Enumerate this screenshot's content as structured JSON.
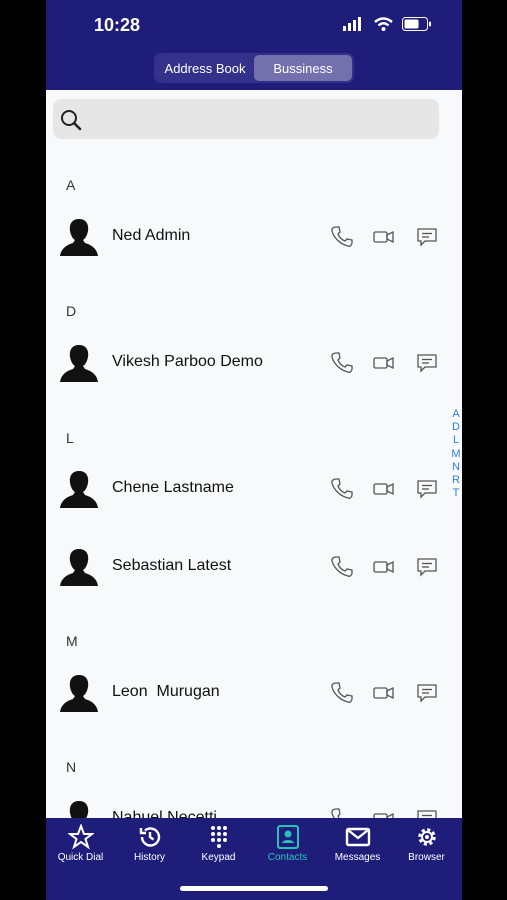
{
  "status_bar": {
    "time": "10:28"
  },
  "segment": {
    "address_book": "Address Book",
    "business": "Bussiness"
  },
  "sections": [
    {
      "letter": "A",
      "contacts": [
        "Ned Admin"
      ]
    },
    {
      "letter": "D",
      "contacts": [
        "Vikesh Parboo Demo"
      ]
    },
    {
      "letter": "L",
      "contacts": [
        "Chene Lastname",
        "Sebastian Latest"
      ]
    },
    {
      "letter": "M",
      "contacts": [
        "Leon  Murugan"
      ]
    },
    {
      "letter": "N",
      "contacts": [
        "Nahuel Necetti"
      ]
    }
  ],
  "index": [
    "A",
    "D",
    "L",
    "M",
    "N",
    "R",
    "T"
  ],
  "tabs": {
    "quick_dial": "Quick Dial",
    "history": "History",
    "keypad": "Keypad",
    "contacts": "Contacts",
    "messages": "Messages",
    "browser": "Browser"
  },
  "colors": {
    "header": "#1f1d7a",
    "active_tab": "#26c3b9",
    "index": "#2d7de8"
  }
}
